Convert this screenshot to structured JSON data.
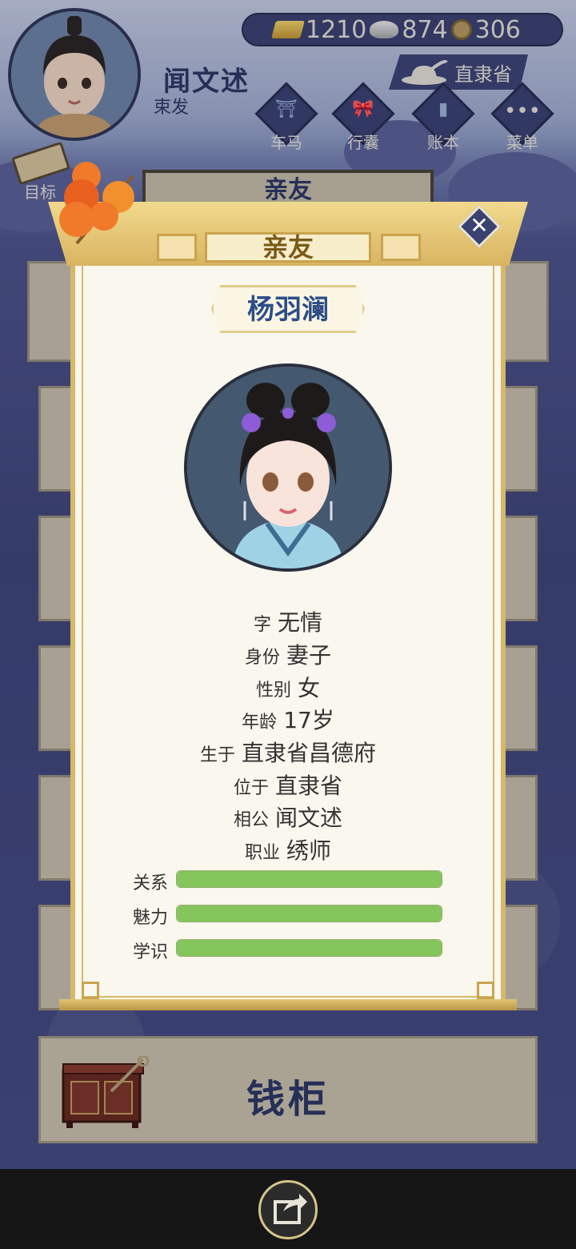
{
  "resources": {
    "gold": "1210",
    "silver": "874",
    "coins": "306"
  },
  "player": {
    "name": "闻文述",
    "hair": "束发"
  },
  "location": "直隶省",
  "top_buttons": [
    {
      "label": "车马",
      "icon": "carriage-icon"
    },
    {
      "label": "行囊",
      "icon": "bag-icon"
    },
    {
      "label": "账本",
      "icon": "ledger-icon"
    },
    {
      "label": "菜单",
      "icon": "menu-icon"
    }
  ],
  "target_label": "目标",
  "background_title": "亲友",
  "money_cabinet_label": "钱柜",
  "modal": {
    "title": "亲友",
    "npc_name": "杨羽澜",
    "details": [
      {
        "key": "字",
        "value": "无情"
      },
      {
        "key": "身份",
        "value": "妻子"
      },
      {
        "key": "性别",
        "value": "女"
      },
      {
        "key": "年龄",
        "value": "17岁"
      },
      {
        "key": "生于",
        "value": "直隶省昌德府"
      },
      {
        "key": "位于",
        "value": "直隶省"
      },
      {
        "key": "相公",
        "value": "闻文述"
      },
      {
        "key": "职业",
        "value": "绣师"
      }
    ],
    "stats": [
      {
        "label": "关系",
        "fill": 1.0
      },
      {
        "label": "魅力",
        "fill": 1.0
      },
      {
        "label": "学识",
        "fill": 1.0
      }
    ]
  },
  "colors": {
    "accent_gold": "#d6b867",
    "navy": "#2c3863",
    "stat_green": "#84c55c"
  }
}
